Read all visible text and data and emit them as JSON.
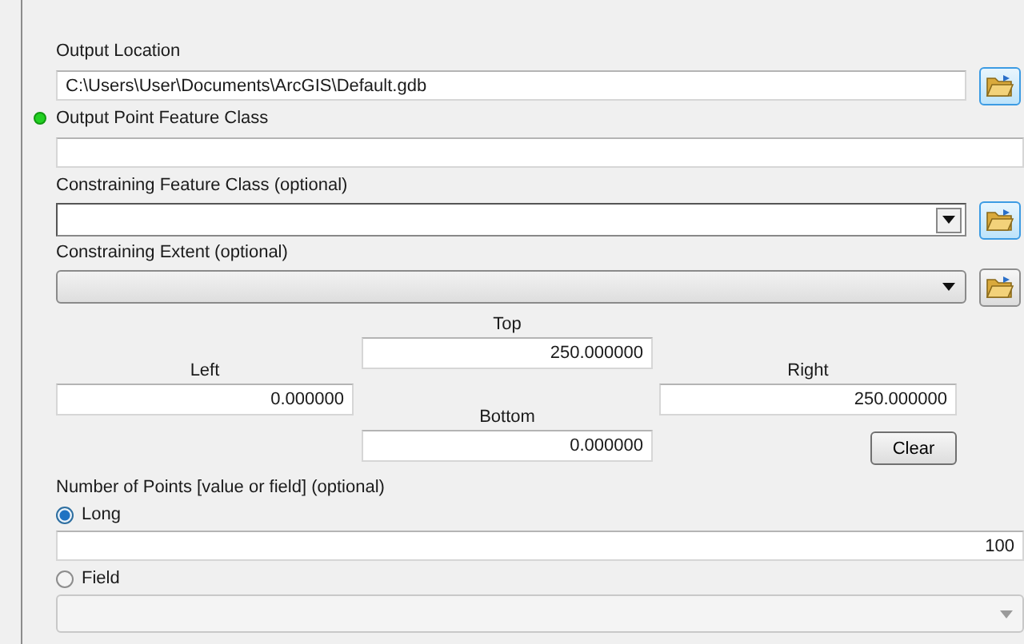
{
  "parameters": [
    {
      "kind": "text",
      "label": "Output Location",
      "value": "C:\\Users\\User\\Documents\\ArcGIS\\Default.gdb",
      "required": false,
      "browse": {
        "highlighted": true
      }
    },
    {
      "kind": "text",
      "label": "Output Point Feature Class",
      "required": true
    },
    {
      "kind": "editable-combo",
      "label": "Constraining Feature Class (optional)",
      "required": false,
      "browse": {
        "highlighted": true
      }
    },
    {
      "kind": "list-combo",
      "label": "Constraining Extent (optional)",
      "required": false,
      "browse": {
        "highlighted": false
      }
    }
  ],
  "extent": {
    "top": {
      "label": "Top",
      "value": "250.000000"
    },
    "left": {
      "label": "Left",
      "value": "0.000000"
    },
    "right": {
      "label": "Right",
      "value": "250.000000"
    },
    "bottom": {
      "label": "Bottom",
      "value": "0.000000"
    },
    "clear_button": "Clear"
  },
  "number_of_points": {
    "label": "Number of Points [value or field] (optional)",
    "options": [
      {
        "label": "Long",
        "selected": true
      },
      {
        "label": "Field",
        "selected": false
      }
    ],
    "value": "100",
    "field_combo": {
      "enabled": false
    }
  }
}
